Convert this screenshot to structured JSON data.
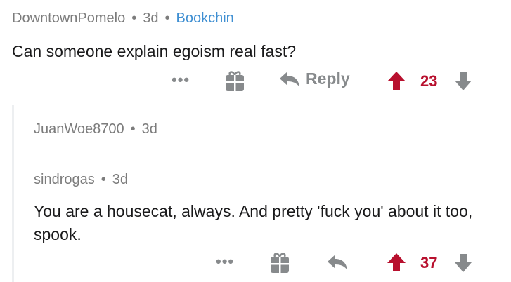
{
  "comment1": {
    "author": "DowntownPomelo",
    "age": "3d",
    "subreddit": "Bookchin",
    "body": "Can someone explain egoism real fast?",
    "more": "•••",
    "reply_label": "Reply",
    "score": "23"
  },
  "comment2": {
    "author": "JuanWoe8700",
    "age": "3d"
  },
  "comment3": {
    "author": "sindrogas",
    "age": "3d",
    "body": "You are a housecat, always. And pretty 'fuck you' about it too, spook.",
    "more": "•••",
    "score": "37"
  },
  "colors": {
    "upvote": "#b8102e",
    "icon_gray": "#878a8c",
    "link_blue": "#3f8fd2",
    "meta_gray": "#7c7c7c"
  },
  "icons": [
    "more-icon",
    "gift-icon",
    "reply-icon",
    "upvote-icon",
    "downvote-icon"
  ]
}
